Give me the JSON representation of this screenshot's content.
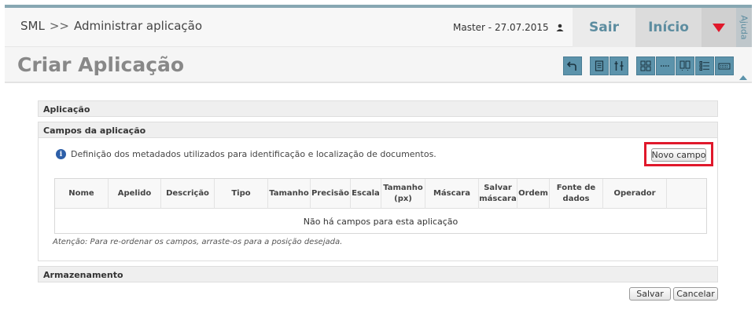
{
  "header": {
    "app_name": "SML",
    "separator": ">>",
    "section": "Administrar aplicação",
    "user": "Master - 27.07.2015",
    "user_icon": "user-icon",
    "nav": {
      "sair": "Sair",
      "inicio": "Início",
      "menu_icon": "triangle-down-icon"
    },
    "help_tab": "Ajuda"
  },
  "page": {
    "title": "Criar Aplicação",
    "toolbar_icons": [
      "back-arrow-icon",
      "document-icon",
      "tools-icon",
      "grid-layout-icon",
      "dotted-line-icon",
      "columns-icon",
      "list-icon",
      "keyboard-icon"
    ]
  },
  "sections": {
    "aplicacao": "Aplicação",
    "campos": "Campos da aplicação",
    "armazenamento": "Armazenamento"
  },
  "campos": {
    "info_text": "Definição dos metadados utilizados para identificação e localização de documentos.",
    "novo_campo_label": "Novo campo",
    "columns": [
      "Nome",
      "Apelido",
      "Descrição",
      "Tipo",
      "Tamanho",
      "Precisão",
      "Escala",
      "Tamanho (px)",
      "Máscara",
      "Salvar máscara",
      "Ordem",
      "Fonte de dados",
      "Operador",
      ""
    ],
    "empty_message": "Não há campos para esta aplicação",
    "note": "Atenção: Para re-ordenar os campos, arraste-os para a posição desejada."
  },
  "actions": {
    "salvar": "Salvar",
    "cancelar": "Cancelar"
  },
  "colors": {
    "accent": "#5c93ab",
    "highlight": "#e0182b",
    "header_bar": "#87a7b2"
  }
}
